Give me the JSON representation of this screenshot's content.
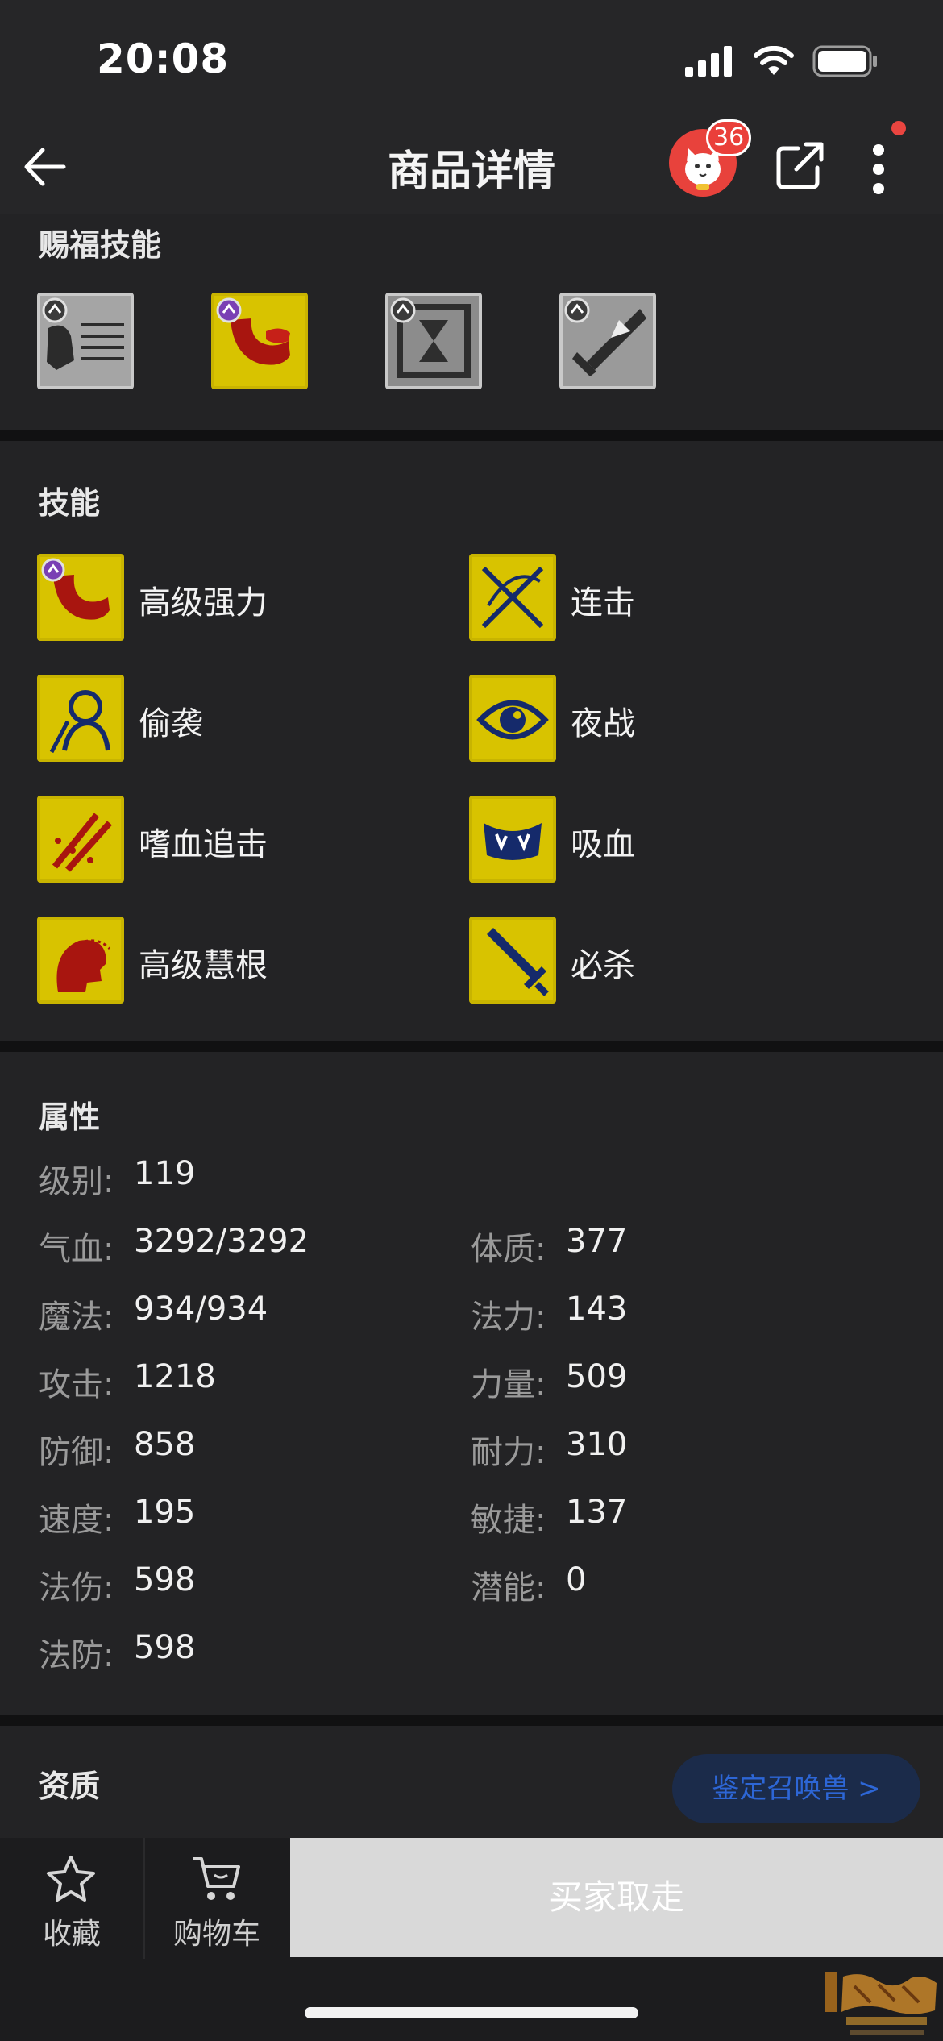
{
  "status_bar": {
    "time": "20:08"
  },
  "nav": {
    "title": "商品详情",
    "badge_count": "36"
  },
  "blessing": {
    "title": "赐福技能",
    "icons": [
      "blessing-skill-1-icon",
      "blessing-skill-2-icon",
      "blessing-skill-3-icon",
      "blessing-skill-4-icon"
    ]
  },
  "skills": {
    "title": "技能",
    "items": [
      {
        "label": "高级强力"
      },
      {
        "label": "连击"
      },
      {
        "label": "偷袭"
      },
      {
        "label": "夜战"
      },
      {
        "label": "嗜血追击"
      },
      {
        "label": "吸血"
      },
      {
        "label": "高级慧根"
      },
      {
        "label": "必杀"
      }
    ]
  },
  "attributes": {
    "title": "属性",
    "level": {
      "label": "级别:",
      "value": "119"
    },
    "left": [
      {
        "label": "气血:",
        "value": "3292/3292"
      },
      {
        "label": "魔法:",
        "value": "934/934"
      },
      {
        "label": "攻击:",
        "value": "1218"
      },
      {
        "label": "防御:",
        "value": "858"
      },
      {
        "label": "速度:",
        "value": "195"
      },
      {
        "label": "法伤:",
        "value": "598"
      },
      {
        "label": "法防:",
        "value": "598"
      }
    ],
    "right": [
      {
        "label": "体质:",
        "value": "377"
      },
      {
        "label": "法力:",
        "value": "143"
      },
      {
        "label": "力量:",
        "value": "509"
      },
      {
        "label": "耐力:",
        "value": "310"
      },
      {
        "label": "敏捷:",
        "value": "137"
      },
      {
        "label": "潜能:",
        "value": "0"
      }
    ]
  },
  "aptitude": {
    "title": "资质",
    "appraise_label": "鉴定召唤兽 >"
  },
  "bottom": {
    "favorite_label": "收藏",
    "cart_label": "购物车",
    "buy_label": "买家取走"
  },
  "colors": {
    "background": "#1c1c1e",
    "section_bg": "#232325",
    "skill_gold": "#d8c300",
    "skill_red": "#a8150f",
    "badge_red": "#ea3f3a",
    "appraise_blue": "#2d66d6"
  }
}
